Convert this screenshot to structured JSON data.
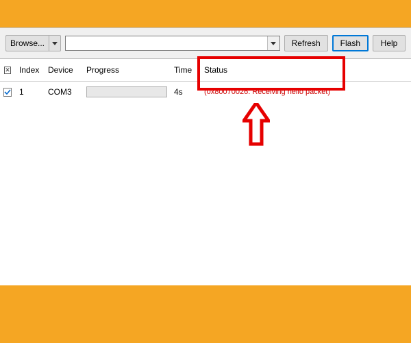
{
  "toolbar": {
    "browse_label": "Browse...",
    "combo_value": "",
    "refresh_label": "Refresh",
    "flash_label": "Flash",
    "help_label": "Help"
  },
  "table": {
    "headers": {
      "index": "Index",
      "device": "Device",
      "progress": "Progress",
      "time": "Time",
      "status": "Status"
    },
    "rows": [
      {
        "checked": true,
        "index": "1",
        "device": "COM3",
        "time": "4s",
        "status": "(0x80070026: Receiving hello packet)"
      }
    ]
  },
  "icons": {
    "header_clear": "✕"
  }
}
